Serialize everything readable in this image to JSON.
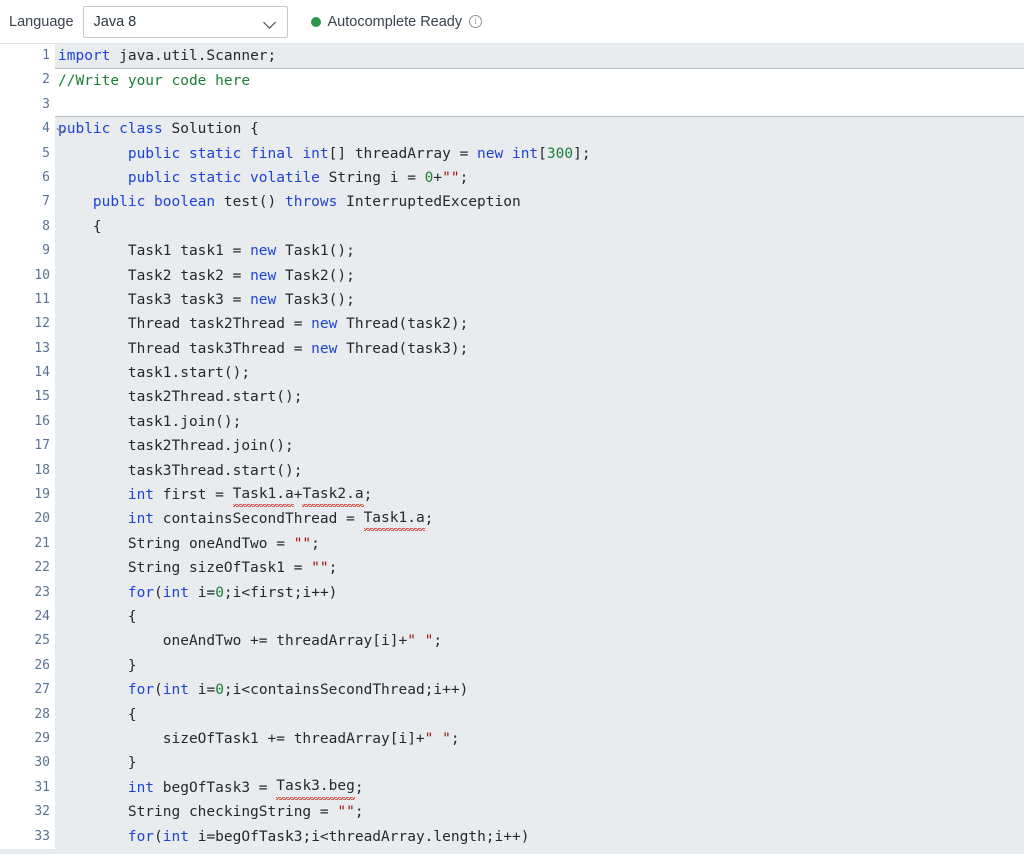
{
  "toolbar": {
    "language_label": "Language",
    "language_value": "Java 8",
    "language_options": [
      "Java 8"
    ],
    "chevron_icon": "chevron-down-icon",
    "status_text": "Autocomplete Ready",
    "status_dot_color": "#2e9648",
    "info_icon": "info-icon"
  },
  "editor": {
    "first_line": 1,
    "last_line": 33,
    "theme": {
      "keyword_color": "#1d43d8",
      "number_color": "#1a7f37",
      "string_color": "#a31515",
      "comment_color": "#1a7f37",
      "plain_color": "#24292e",
      "readonly_bg": "#e8ecef",
      "editable_bg": "#ffffff",
      "gutter_bg": "#ffffff",
      "lineno_color": "#5b7392",
      "error_squiggle_color": "#d93025"
    },
    "lines": [
      {
        "n": 1,
        "editable": false,
        "fold": false,
        "tokens": [
          {
            "t": "import",
            "c": "kw"
          },
          {
            "t": " java.util.Scanner;",
            "c": "pl"
          }
        ]
      },
      {
        "n": 2,
        "editable": true,
        "fold": false,
        "tokens": [
          {
            "t": "//Write your code here",
            "c": "cmt"
          }
        ]
      },
      {
        "n": 3,
        "editable": true,
        "fold": false,
        "tokens": []
      },
      {
        "n": 4,
        "editable": false,
        "fold": true,
        "tokens": [
          {
            "t": "public class",
            "c": "kw"
          },
          {
            "t": " Solution {",
            "c": "pl"
          }
        ]
      },
      {
        "n": 5,
        "editable": false,
        "fold": false,
        "tokens": [
          {
            "t": "        ",
            "c": "pl"
          },
          {
            "t": "public static final int",
            "c": "kw"
          },
          {
            "t": "[] threadArray = ",
            "c": "pl"
          },
          {
            "t": "new int",
            "c": "kw"
          },
          {
            "t": "[",
            "c": "pl"
          },
          {
            "t": "300",
            "c": "num"
          },
          {
            "t": "];",
            "c": "pl"
          }
        ]
      },
      {
        "n": 6,
        "editable": false,
        "fold": false,
        "tokens": [
          {
            "t": "        ",
            "c": "pl"
          },
          {
            "t": "public static volatile",
            "c": "kw"
          },
          {
            "t": " String i = ",
            "c": "pl"
          },
          {
            "t": "0",
            "c": "num"
          },
          {
            "t": "+",
            "c": "pl"
          },
          {
            "t": "\"\"",
            "c": "str"
          },
          {
            "t": ";",
            "c": "pl"
          }
        ]
      },
      {
        "n": 7,
        "editable": false,
        "fold": false,
        "tokens": [
          {
            "t": "    ",
            "c": "pl"
          },
          {
            "t": "public boolean",
            "c": "kw"
          },
          {
            "t": " test() ",
            "c": "pl"
          },
          {
            "t": "throws",
            "c": "kw"
          },
          {
            "t": " InterruptedException",
            "c": "pl"
          }
        ]
      },
      {
        "n": 8,
        "editable": false,
        "fold": false,
        "tokens": [
          {
            "t": "    {",
            "c": "pl"
          }
        ]
      },
      {
        "n": 9,
        "editable": false,
        "fold": false,
        "tokens": [
          {
            "t": "        Task1 task1 = ",
            "c": "pl"
          },
          {
            "t": "new",
            "c": "kw"
          },
          {
            "t": " Task1();",
            "c": "pl"
          }
        ]
      },
      {
        "n": 10,
        "editable": false,
        "fold": false,
        "tokens": [
          {
            "t": "        Task2 task2 = ",
            "c": "pl"
          },
          {
            "t": "new",
            "c": "kw"
          },
          {
            "t": " Task2();",
            "c": "pl"
          }
        ]
      },
      {
        "n": 11,
        "editable": false,
        "fold": false,
        "tokens": [
          {
            "t": "        Task3 task3 = ",
            "c": "pl"
          },
          {
            "t": "new",
            "c": "kw"
          },
          {
            "t": " Task3();",
            "c": "pl"
          }
        ]
      },
      {
        "n": 12,
        "editable": false,
        "fold": false,
        "tokens": [
          {
            "t": "        Thread task2Thread = ",
            "c": "pl"
          },
          {
            "t": "new",
            "c": "kw"
          },
          {
            "t": " Thread(task2);",
            "c": "pl"
          }
        ]
      },
      {
        "n": 13,
        "editable": false,
        "fold": false,
        "tokens": [
          {
            "t": "        Thread task3Thread = ",
            "c": "pl"
          },
          {
            "t": "new",
            "c": "kw"
          },
          {
            "t": " Thread(task3);",
            "c": "pl"
          }
        ]
      },
      {
        "n": 14,
        "editable": false,
        "fold": false,
        "tokens": [
          {
            "t": "        task1.start();",
            "c": "pl"
          }
        ]
      },
      {
        "n": 15,
        "editable": false,
        "fold": false,
        "tokens": [
          {
            "t": "        task2Thread.start();",
            "c": "pl"
          }
        ]
      },
      {
        "n": 16,
        "editable": false,
        "fold": false,
        "tokens": [
          {
            "t": "        task1.join();",
            "c": "pl"
          }
        ]
      },
      {
        "n": 17,
        "editable": false,
        "fold": false,
        "tokens": [
          {
            "t": "        task2Thread.join();",
            "c": "pl"
          }
        ]
      },
      {
        "n": 18,
        "editable": false,
        "fold": false,
        "tokens": [
          {
            "t": "        task3Thread.start();",
            "c": "pl"
          }
        ]
      },
      {
        "n": 19,
        "editable": false,
        "fold": false,
        "tokens": [
          {
            "t": "        ",
            "c": "pl"
          },
          {
            "t": "int",
            "c": "kw"
          },
          {
            "t": " first = ",
            "c": "pl"
          },
          {
            "t": "Task1.a",
            "c": "pl",
            "err": true
          },
          {
            "t": "+",
            "c": "pl"
          },
          {
            "t": "Task2.a",
            "c": "pl",
            "err": true
          },
          {
            "t": ";",
            "c": "pl"
          }
        ]
      },
      {
        "n": 20,
        "editable": false,
        "fold": false,
        "tokens": [
          {
            "t": "        ",
            "c": "pl"
          },
          {
            "t": "int",
            "c": "kw"
          },
          {
            "t": " containsSecondThread = ",
            "c": "pl"
          },
          {
            "t": "Task1.a",
            "c": "pl",
            "err": true
          },
          {
            "t": ";",
            "c": "pl"
          }
        ]
      },
      {
        "n": 21,
        "editable": false,
        "fold": false,
        "tokens": [
          {
            "t": "        String oneAndTwo = ",
            "c": "pl"
          },
          {
            "t": "\"\"",
            "c": "str"
          },
          {
            "t": ";",
            "c": "pl"
          }
        ]
      },
      {
        "n": 22,
        "editable": false,
        "fold": false,
        "tokens": [
          {
            "t": "        String sizeOfTask1 = ",
            "c": "pl"
          },
          {
            "t": "\"\"",
            "c": "str"
          },
          {
            "t": ";",
            "c": "pl"
          }
        ]
      },
      {
        "n": 23,
        "editable": false,
        "fold": false,
        "tokens": [
          {
            "t": "        ",
            "c": "pl"
          },
          {
            "t": "for",
            "c": "kw"
          },
          {
            "t": "(",
            "c": "pl"
          },
          {
            "t": "int",
            "c": "kw"
          },
          {
            "t": " i=",
            "c": "pl"
          },
          {
            "t": "0",
            "c": "num"
          },
          {
            "t": ";i<first;i++)",
            "c": "pl"
          }
        ]
      },
      {
        "n": 24,
        "editable": false,
        "fold": false,
        "tokens": [
          {
            "t": "        {",
            "c": "pl"
          }
        ]
      },
      {
        "n": 25,
        "editable": false,
        "fold": false,
        "tokens": [
          {
            "t": "            oneAndTwo += threadArray[i]+",
            "c": "pl"
          },
          {
            "t": "\" \"",
            "c": "str"
          },
          {
            "t": ";",
            "c": "pl"
          }
        ]
      },
      {
        "n": 26,
        "editable": false,
        "fold": false,
        "tokens": [
          {
            "t": "        }",
            "c": "pl"
          }
        ]
      },
      {
        "n": 27,
        "editable": false,
        "fold": false,
        "tokens": [
          {
            "t": "        ",
            "c": "pl"
          },
          {
            "t": "for",
            "c": "kw"
          },
          {
            "t": "(",
            "c": "pl"
          },
          {
            "t": "int",
            "c": "kw"
          },
          {
            "t": " i=",
            "c": "pl"
          },
          {
            "t": "0",
            "c": "num"
          },
          {
            "t": ";i<containsSecondThread;i++)",
            "c": "pl"
          }
        ]
      },
      {
        "n": 28,
        "editable": false,
        "fold": false,
        "tokens": [
          {
            "t": "        {",
            "c": "pl"
          }
        ]
      },
      {
        "n": 29,
        "editable": false,
        "fold": false,
        "tokens": [
          {
            "t": "            sizeOfTask1 += threadArray[i]+",
            "c": "pl"
          },
          {
            "t": "\" \"",
            "c": "str"
          },
          {
            "t": ";",
            "c": "pl"
          }
        ]
      },
      {
        "n": 30,
        "editable": false,
        "fold": false,
        "tokens": [
          {
            "t": "        }",
            "c": "pl"
          }
        ]
      },
      {
        "n": 31,
        "editable": false,
        "fold": false,
        "tokens": [
          {
            "t": "        ",
            "c": "pl"
          },
          {
            "t": "int",
            "c": "kw"
          },
          {
            "t": " begOfTask3 = ",
            "c": "pl"
          },
          {
            "t": "Task3.beg",
            "c": "pl",
            "err": true
          },
          {
            "t": ";",
            "c": "pl"
          }
        ]
      },
      {
        "n": 32,
        "editable": false,
        "fold": false,
        "tokens": [
          {
            "t": "        String checkingString = ",
            "c": "pl"
          },
          {
            "t": "\"\"",
            "c": "str"
          },
          {
            "t": ";",
            "c": "pl"
          }
        ]
      },
      {
        "n": 33,
        "editable": false,
        "fold": false,
        "tokens": [
          {
            "t": "        ",
            "c": "pl"
          },
          {
            "t": "for",
            "c": "kw"
          },
          {
            "t": "(",
            "c": "pl"
          },
          {
            "t": "int",
            "c": "kw"
          },
          {
            "t": " i=begOfTask3;i<threadArray.length;i++)",
            "c": "pl"
          }
        ]
      }
    ]
  }
}
